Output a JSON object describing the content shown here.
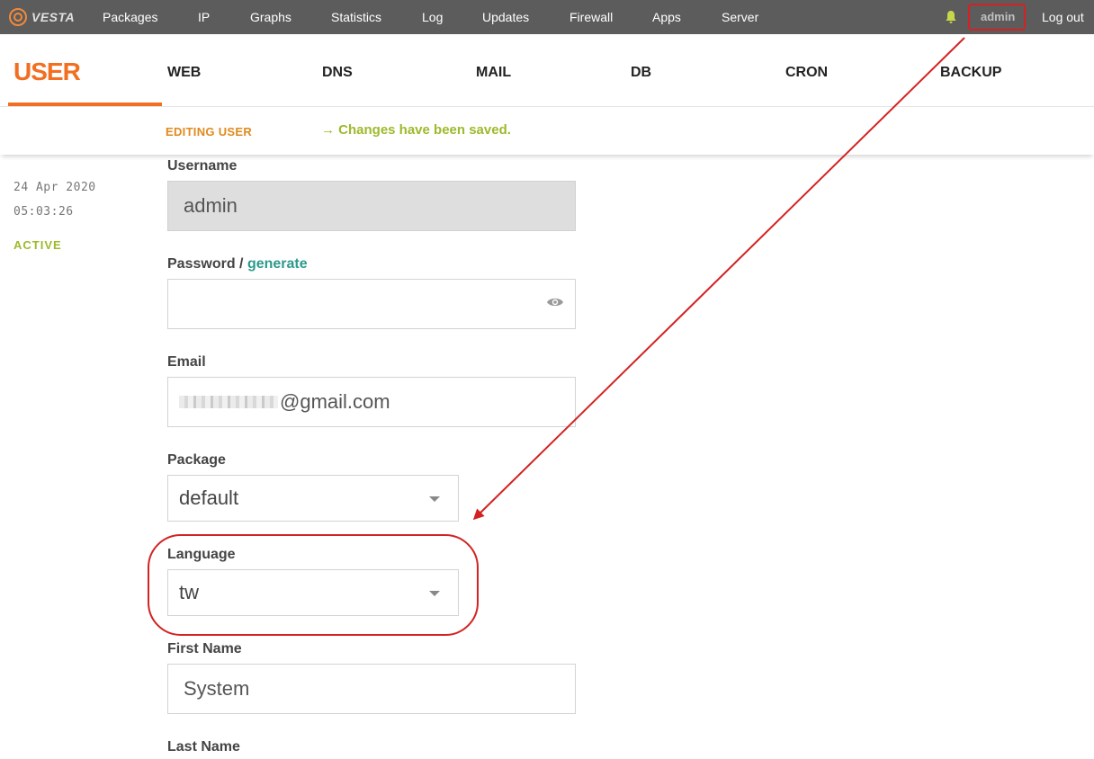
{
  "app": {
    "logo_text": "VESTA"
  },
  "topnav": {
    "items": [
      "Packages",
      "IP",
      "Graphs",
      "Statistics",
      "Log",
      "Updates",
      "Firewall",
      "Apps",
      "Server"
    ],
    "user": "admin",
    "logout": "Log out"
  },
  "tabs": {
    "active": "USER",
    "items": [
      "WEB",
      "DNS",
      "MAIL",
      "DB",
      "CRON",
      "BACKUP"
    ]
  },
  "subheader": {
    "title": "EDITING USER",
    "message": "→ Changes have been saved."
  },
  "meta": {
    "date": "24 Apr 2020",
    "time": "05:03:26",
    "status": "ACTIVE"
  },
  "form": {
    "username_label": "Username",
    "username_value": "admin",
    "password_label": "Password /",
    "password_generate": "generate",
    "password_value": "",
    "email_label": "Email",
    "email_value": "@gmail.com",
    "package_label": "Package",
    "package_value": "default",
    "language_label": "Language",
    "language_value": "tw",
    "firstname_label": "First Name",
    "firstname_value": "System",
    "lastname_label": "Last Name"
  },
  "colors": {
    "topbar": "#5c5c5c",
    "accent_orange": "#f26f21",
    "success_green": "#9cba2b",
    "link_teal": "#2c9a8c",
    "annotation_red": "#d32222"
  },
  "icons": {
    "bell": "bell-icon",
    "eye": "eye-icon",
    "caret": "chevron-down-icon"
  }
}
